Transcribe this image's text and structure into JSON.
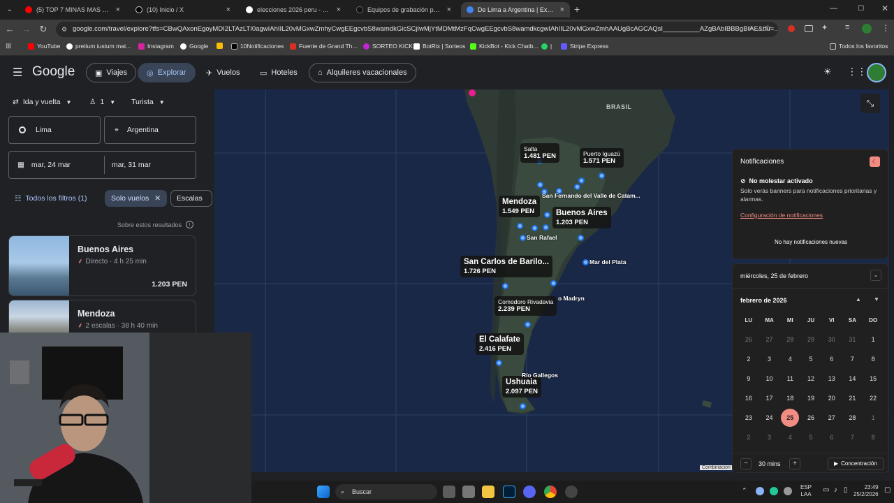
{
  "browser": {
    "tabs": [
      {
        "title": "(5) TOP 7 MINAS MAS FACILES",
        "color": "#ff0000"
      },
      {
        "title": "(10) Inicio / X",
        "color": "#ffffff"
      },
      {
        "title": "elecciones 2026 peru - Buscar c",
        "color": "#4285f4"
      },
      {
        "title": "Equipos de grabación para con",
        "color": "#000000"
      },
      {
        "title": "De Lima a Argentina | Explorar",
        "color": "#4285f4"
      }
    ],
    "url": "google.com/travel/explore?tfs=CBwQAxonEgoyMDI2LTAzLTI0agwIAhIIL20vMGxwZmhyCwgEEgcvbS8wamdkGicSCjIwMjYtMDMtMzFqCwgEEgcvbS8wamdkcgwIAhIIL20vMGxwZmhAAUgBcAGCAQsI__________AZgBAbIBBBgBIAE&tfu=...",
    "bookmarks": [
      "YouTube",
      "pretium iustum mat...",
      "Instagram",
      "Google",
      "",
      "10Notificaciones",
      "Fuente de Grand Th...",
      "SORTEO KICK",
      "BotRix | Sorteos",
      "KickBot - Kick Chatb...",
      "|",
      "Stripe Express"
    ],
    "all_bookmarks": "Todos los favoritos"
  },
  "header": {
    "logo": "Google",
    "nav": [
      "Viajes",
      "Explorar",
      "Vuelos",
      "Hoteles",
      "Alquileres vacacionales"
    ]
  },
  "search": {
    "trip_type": "Ida y vuelta",
    "passengers": "1",
    "cabin": "Turista",
    "origin": "Lima",
    "destination": "Argentina",
    "depart": "mar, 24 mar",
    "return": "mar, 31 mar",
    "all_filters": "Todos los filtros (1)",
    "chip_flights": "Solo vuelos",
    "chip_stops": "Escalas",
    "about_results": "Sobre estos resultados"
  },
  "results": [
    {
      "city": "Buenos Aires",
      "details": "Directo · 4 h 25 min",
      "price": "1.203 PEN"
    },
    {
      "city": "Mendoza",
      "details": "2 escalas · 38 h 40 min",
      "price": ""
    }
  ],
  "map": {
    "country_label": "BRASIL",
    "price_labels": [
      {
        "name": "Salta",
        "price": "1.481 PEN"
      },
      {
        "name": "Puerto Iguazú",
        "price": "1.571 PEN"
      },
      {
        "name": "Mendoza",
        "price": "1.549 PEN"
      },
      {
        "name": "Buenos Aires",
        "price": "1.203 PEN"
      },
      {
        "name": "San Carlos de Barilo...",
        "price": "1.726 PEN"
      },
      {
        "name": "Comodoro Rivadavia",
        "price": "2.239 PEN"
      },
      {
        "name": "El Calafate",
        "price": "2.416 PEN"
      },
      {
        "name": "Ushuaia",
        "price": "2.097 PEN"
      }
    ],
    "city_labels": [
      "San Fernando del Valle de Catam...",
      "San Rafael",
      "Mar del Plata",
      "o Madryn",
      "Río Gallegos"
    ],
    "footer": "Combinacion"
  },
  "notifications": {
    "title": "Notificaciones",
    "dnd_title": "No molestar activado",
    "dnd_body": "Solo verás banners para notificaciones prioritarias y alarmas.",
    "settings_link": "Configuración de notificaciones",
    "empty": "No hay notificaciones nuevas"
  },
  "calendar": {
    "date_header": "miércoles, 25 de febrero",
    "month": "febrero de 2026",
    "weekdays": [
      "LU",
      "MA",
      "MI",
      "JU",
      "VI",
      "SA",
      "DO"
    ],
    "days": [
      "26",
      "27",
      "28",
      "29",
      "30",
      "31",
      "1",
      "2",
      "3",
      "4",
      "5",
      "6",
      "7",
      "8",
      "9",
      "10",
      "11",
      "12",
      "13",
      "14",
      "15",
      "16",
      "17",
      "18",
      "19",
      "20",
      "21",
      "22",
      "23",
      "24",
      "25",
      "26",
      "27",
      "28",
      "1",
      "2",
      "3",
      "4",
      "5",
      "6",
      "7",
      "8"
    ],
    "today": "25",
    "focus_minutes": "30 mins",
    "focus_button": "Concentración"
  },
  "taskbar": {
    "search": "Buscar",
    "lang": "ESP",
    "lang2": "LAA",
    "time": "23:49",
    "date": "25/2/2026"
  }
}
